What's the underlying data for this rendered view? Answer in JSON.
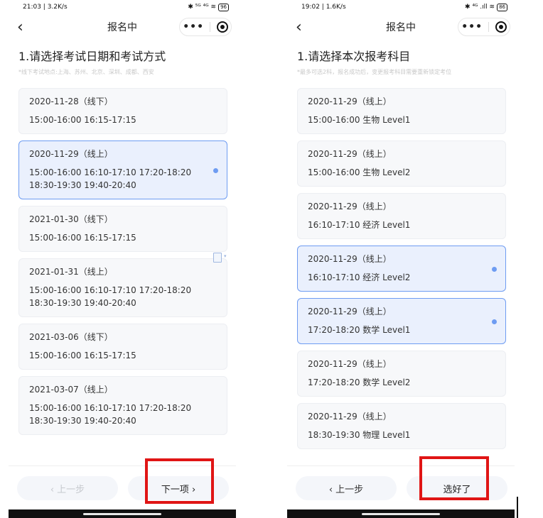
{
  "left": {
    "status": {
      "time": "21:03 | 3.2K/s",
      "right_icons": "✱ ⁵ᴳ ⁴ᴳ ≋",
      "battery": "96"
    },
    "nav": {
      "back": "‹",
      "title": "报名中",
      "more": "•••"
    },
    "heading": "1.请选择考试日期和考试方式",
    "hint": "*线下考试地点:上海、苏州、北京、深圳、成都、西安",
    "cards": [
      {
        "line1": "2020-11-28（线下）",
        "line2": "15:00-16:00   16:15-17:15",
        "selected": false
      },
      {
        "line1": "2020-11-29（线上）",
        "line2": "15:00-16:00   16:10-17:10   17:20-18:20   18:30-19:30   19:40-20:40",
        "selected": true
      },
      {
        "line1": "2021-01-30（线下）",
        "line2": "15:00-16:00   16:15-17:15",
        "selected": false
      },
      {
        "line1": "2021-01-31（线上）",
        "line2": "15:00-16:00   16:10-17:10   17:20-18:20   18:30-19:30   19:40-20:40",
        "selected": false
      },
      {
        "line1": "2021-03-06（线下）",
        "line2": "15:00-16:00   16:15-17:15",
        "selected": false
      },
      {
        "line1": "2021-03-07（线上）",
        "line2": "15:00-16:00   16:10-17:10   17:20-18:20   18:30-19:30   19:40-20:40",
        "selected": false
      }
    ],
    "footer": {
      "prev": "‹ 上一步",
      "next": "下一项 ›"
    }
  },
  "right": {
    "status": {
      "time": "19:02 | 1.6K/s",
      "right_icons": "✱ ⁴ᴳ .ıll ≋",
      "battery": "86"
    },
    "nav": {
      "back": "‹",
      "title": "报名中",
      "more": "•••"
    },
    "heading": "1.请选择本次报考科目",
    "hint": "*最多可选2科，报名成功后，变更报考科目需要重新锁定考位",
    "cards": [
      {
        "line1": "2020-11-29（线上）",
        "line2": "15:00-16:00     生物   Level1",
        "selected": false
      },
      {
        "line1": "2020-11-29（线上）",
        "line2": "15:00-16:00     生物   Level2",
        "selected": false
      },
      {
        "line1": "2020-11-29（线上）",
        "line2": "16:10-17:10     经济   Level1",
        "selected": false
      },
      {
        "line1": "2020-11-29（线上）",
        "line2": "16:10-17:10     经济   Level2",
        "selected": true
      },
      {
        "line1": "2020-11-29（线上）",
        "line2": "17:20-18:20     数学   Level1",
        "selected": true
      },
      {
        "line1": "2020-11-29（线上）",
        "line2": "17:20-18:20     数学   Level2",
        "selected": false
      },
      {
        "line1": "2020-11-29（线上）",
        "line2": "18:30-19:30     物理   Level1",
        "selected": false
      }
    ],
    "footer": {
      "prev": "‹ 上一步",
      "next": "选好了"
    }
  },
  "colors": {
    "accent": "#6e9cf2",
    "selected_bg": "#eaf0fd",
    "highlight_box": "#e01515"
  }
}
